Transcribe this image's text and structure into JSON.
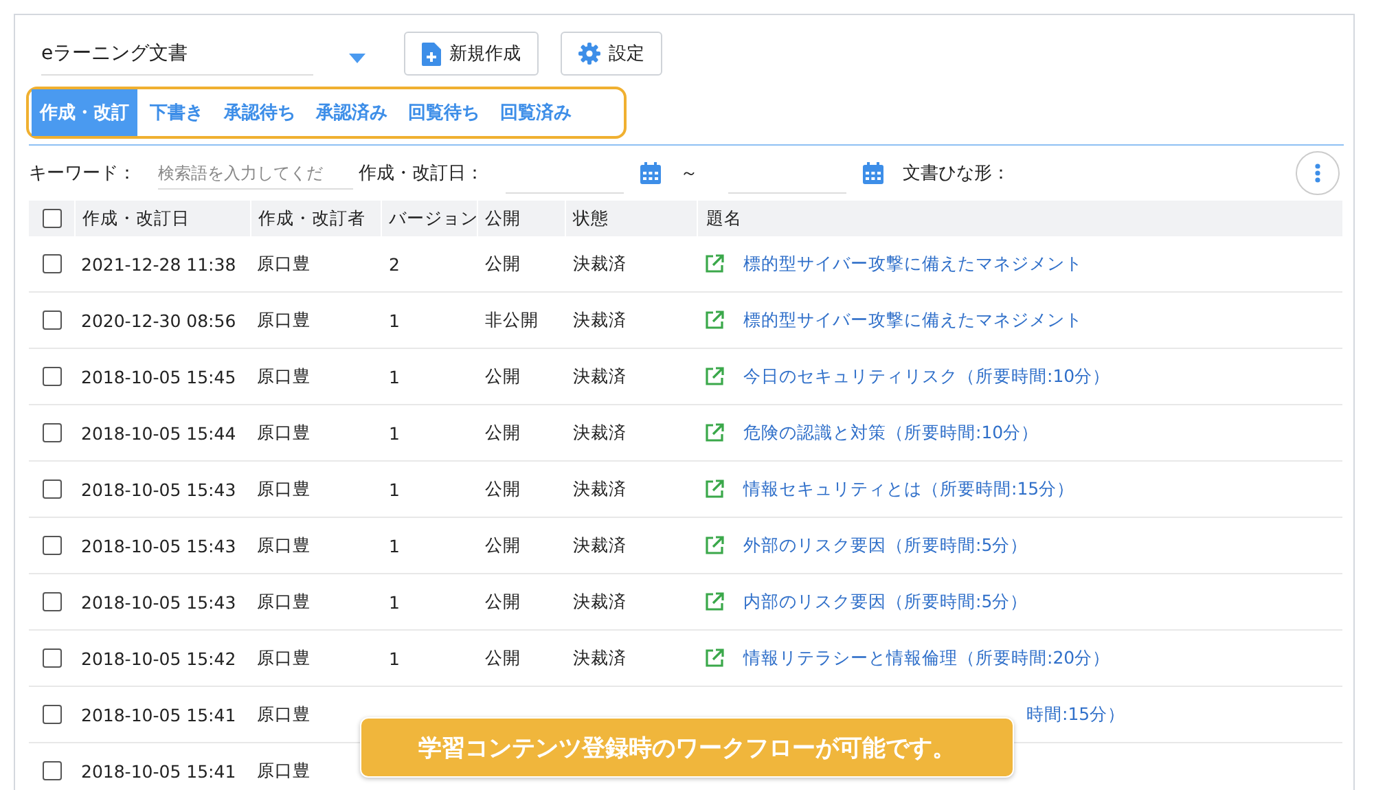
{
  "document_type": {
    "value": "eラーニング文書"
  },
  "buttons": [
    {
      "kind": "new",
      "label": "新規作成"
    },
    {
      "kind": "settings",
      "label": "設定"
    }
  ],
  "tabs": [
    {
      "label": "作成・改訂",
      "selected": true
    },
    {
      "label": "下書き",
      "selected": false
    },
    {
      "label": "承認待ち",
      "selected": false
    },
    {
      "label": "承認済み",
      "selected": false
    },
    {
      "label": "回覧待ち",
      "selected": false
    },
    {
      "label": "回覧済み",
      "selected": false
    }
  ],
  "filters": {
    "keyword_label": "キーワード：",
    "keyword_placeholder": "検索語を入力してくだ",
    "date_label": "作成・改訂日：",
    "range_separator": "～",
    "template_label": "文書ひな形："
  },
  "table": {
    "select_all_checked": false,
    "columns": [
      "作成・改訂日",
      "作成・改訂者",
      "バージョン",
      "公開",
      "状態",
      "題名"
    ],
    "rows": [
      {
        "checked": false,
        "date": "2021-12-28 11:38",
        "author": "原口豊",
        "version": "2",
        "public": "公開",
        "status": "決裁済",
        "title": "標的型サイバー攻撃に備えたマネジメント"
      },
      {
        "checked": false,
        "date": "2020-12-30 08:56",
        "author": "原口豊",
        "version": "1",
        "public": "非公開",
        "status": "決裁済",
        "title": "標的型サイバー攻撃に備えたマネジメント"
      },
      {
        "checked": false,
        "date": "2018-10-05 15:45",
        "author": "原口豊",
        "version": "1",
        "public": "公開",
        "status": "決裁済",
        "title": "今日のセキュリティリスク（所要時間:10分）"
      },
      {
        "checked": false,
        "date": "2018-10-05 15:44",
        "author": "原口豊",
        "version": "1",
        "public": "公開",
        "status": "決裁済",
        "title": "危険の認識と対策（所要時間:10分）"
      },
      {
        "checked": false,
        "date": "2018-10-05 15:43",
        "author": "原口豊",
        "version": "1",
        "public": "公開",
        "status": "決裁済",
        "title": "情報セキュリティとは（所要時間:15分）"
      },
      {
        "checked": false,
        "date": "2018-10-05 15:43",
        "author": "原口豊",
        "version": "1",
        "public": "公開",
        "status": "決裁済",
        "title": "外部のリスク要因（所要時間:5分）"
      },
      {
        "checked": false,
        "date": "2018-10-05 15:43",
        "author": "原口豊",
        "version": "1",
        "public": "公開",
        "status": "決裁済",
        "title": "内部のリスク要因（所要時間:5分）"
      },
      {
        "checked": false,
        "date": "2018-10-05 15:42",
        "author": "原口豊",
        "version": "1",
        "public": "公開",
        "status": "決裁済",
        "title": "情報リテラシーと情報倫理（所要時間:20分）"
      },
      {
        "checked": false,
        "date": "2018-10-05 15:41",
        "author": "原口豊",
        "title_tail": "時間:15分）"
      },
      {
        "checked": false,
        "date": "2018-10-05 15:41",
        "author": "原口豊"
      }
    ]
  },
  "callout": "学習コンテンツ登録時のワークフローが可能です。"
}
